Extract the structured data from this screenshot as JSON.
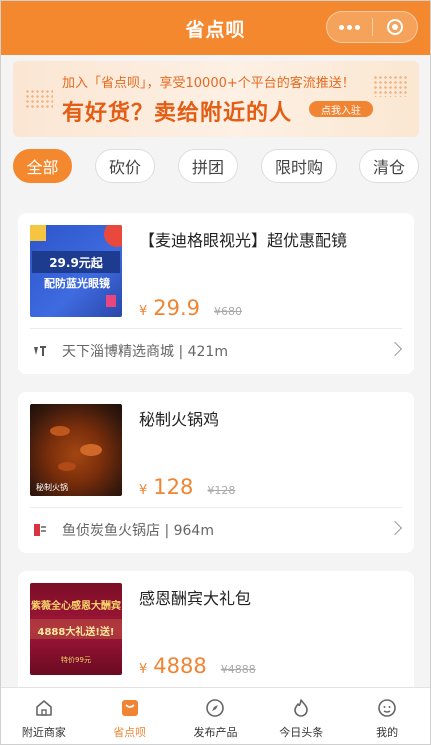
{
  "header": {
    "title": "省点呗"
  },
  "banner": {
    "line1": "加入「省点呗」，享受10000+个平台的客流推送！",
    "line2": "有好货？卖给附近的人",
    "button": "点我入驻"
  },
  "filters": {
    "tabs": [
      "全部",
      "砍价",
      "拼团",
      "限时购",
      "清仓"
    ],
    "active": "全部"
  },
  "products": [
    {
      "title": "【麦迪格眼视光】超优惠配镜",
      "currency": "¥",
      "price": "29.9",
      "original_price": "¥680",
      "shop": "天下淄博精选商城 | 421m",
      "image_text": [
        "29.9元起",
        "配防蓝光眼镜"
      ]
    },
    {
      "title": "秘制火锅鸡",
      "currency": "¥",
      "price": "128",
      "original_price": "¥128",
      "shop": "鱼侦炭鱼火锅店 | 964m",
      "image_text": [
        "秘制火锅"
      ]
    },
    {
      "title": "感恩酬宾大礼包",
      "currency": "¥",
      "price": "4888",
      "original_price": "¥4888",
      "image_text": [
        "紫薇全心感恩大酬宾",
        "4888大礼送!送!",
        "特价99元"
      ]
    }
  ],
  "tabbar": {
    "items": [
      {
        "label": "附近商家",
        "icon": "home-icon"
      },
      {
        "label": "省点呗",
        "icon": "bag-icon"
      },
      {
        "label": "发布产品",
        "icon": "compass-icon"
      },
      {
        "label": "今日头条",
        "icon": "flame-icon"
      },
      {
        "label": "我的",
        "icon": "profile-icon"
      }
    ],
    "active": "省点呗"
  },
  "colors": {
    "accent": "#f3882e",
    "price": "#f08432"
  }
}
